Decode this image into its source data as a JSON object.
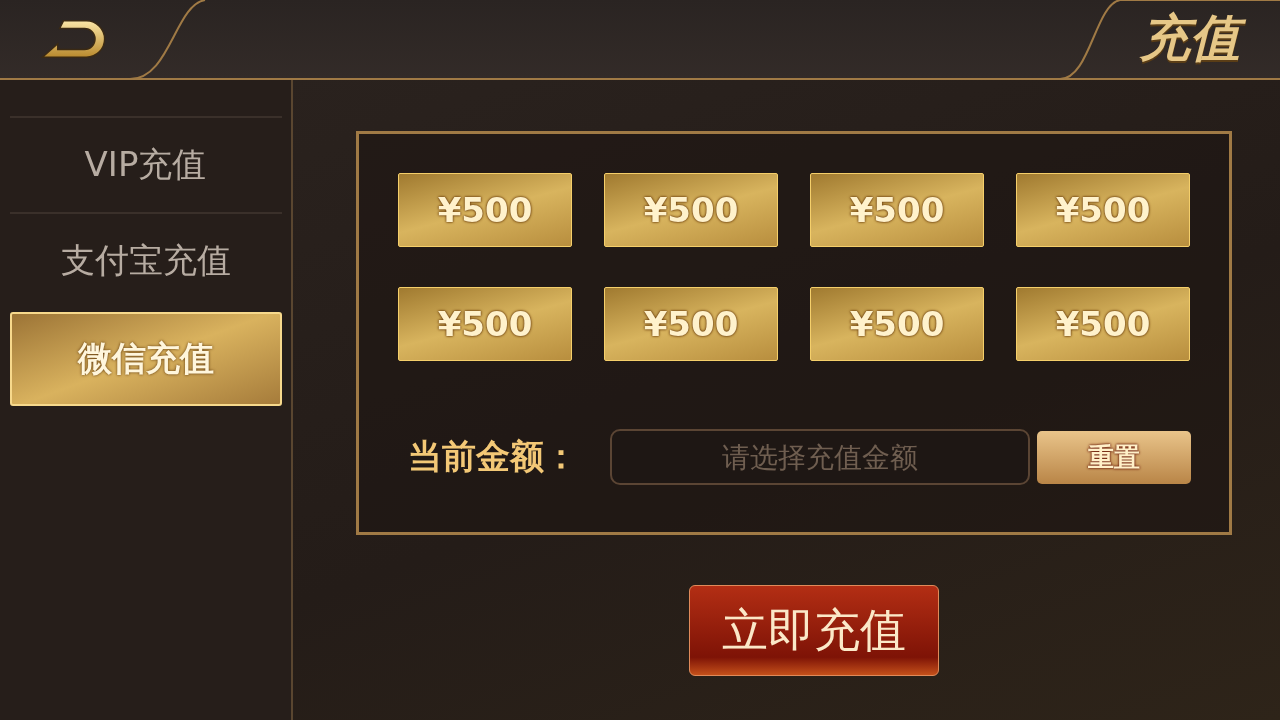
{
  "header": {
    "title": "充值"
  },
  "sidebar": {
    "items": [
      {
        "label": "VIP充值",
        "selected": false
      },
      {
        "label": "支付宝充值",
        "selected": false
      },
      {
        "label": "微信充值",
        "selected": true
      }
    ]
  },
  "amounts": [
    {
      "label": "¥500"
    },
    {
      "label": "¥500"
    },
    {
      "label": "¥500"
    },
    {
      "label": "¥500"
    },
    {
      "label": "¥500"
    },
    {
      "label": "¥500"
    },
    {
      "label": "¥500"
    },
    {
      "label": "¥500"
    }
  ],
  "amount_field": {
    "label": "当前金额：",
    "placeholder": "请选择充值金额"
  },
  "reset_button": "重置",
  "submit_button": "立即充值"
}
